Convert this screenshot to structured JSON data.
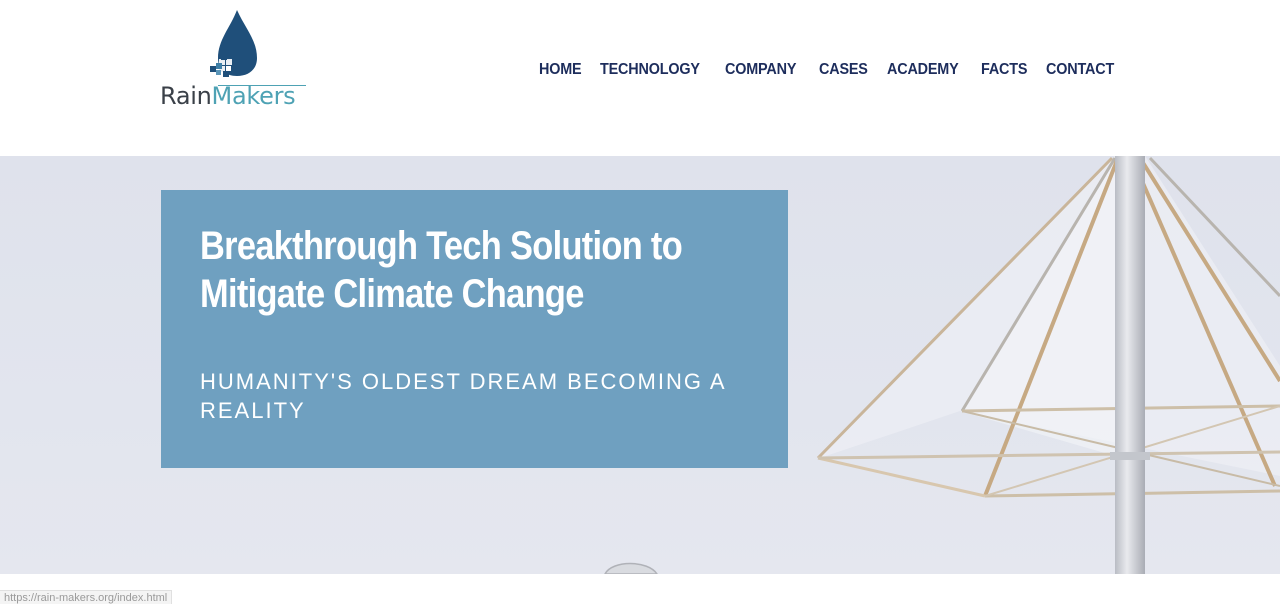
{
  "brand": {
    "name_part1": "Rain",
    "name_part2": "Makers"
  },
  "nav": {
    "items": [
      "HOME",
      "TECHNOLOGY",
      "COMPANY",
      "CASES",
      "ACADEMY",
      "FACTS",
      "CONTACT"
    ]
  },
  "hero": {
    "title_line1": "Breakthrough Tech Solution to",
    "title_line2": "Mitigate Climate Change",
    "subtitle": "HUMANITY'S OLDEST DREAM BECOMING A REALITY"
  },
  "status_bar": {
    "url": "https://rain-makers.org/index.html"
  },
  "colors": {
    "nav_text": "#1d2d5c",
    "hero_box": "#6fa0c0",
    "logo_drop": "#1f4f7a",
    "logo_makers": "#4ea2b4",
    "logo_rain": "#3a4048"
  },
  "icons": {
    "logo": "water-drop-icon"
  }
}
